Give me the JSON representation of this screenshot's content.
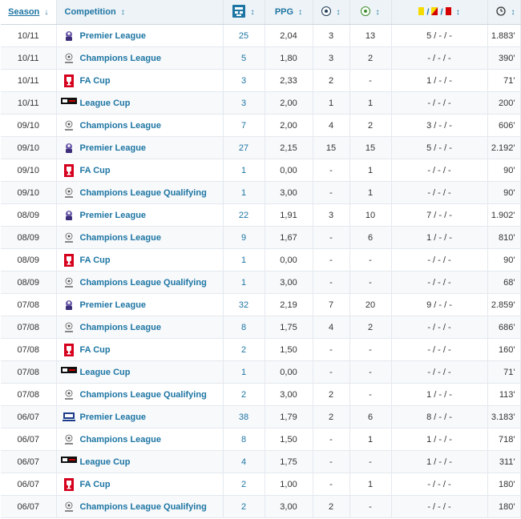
{
  "header": {
    "season": "Season",
    "season_arrow": "↓",
    "competition": "Competition",
    "sort_arrow": "↕",
    "ppg": "PPG",
    "apps_icon": "squad-icon",
    "goals_icon": "football-icon",
    "assists_icon": "assist-football-icon",
    "cards_sep": "/",
    "minutes_icon": "clock-icon"
  },
  "colors": {
    "link": "#1d75a3",
    "header_bg": "#eef3f7",
    "yellow_card": "#f5dc00",
    "red_card": "#d50000"
  },
  "rows": [
    {
      "season": "10/11",
      "competition": "Premier League",
      "logo": "premier-league-logo",
      "apps": "25",
      "ppg": "2,04",
      "goals": "3",
      "assists": "13",
      "cards": "5 / - / -",
      "minutes": "1.883'"
    },
    {
      "season": "10/11",
      "competition": "Champions League",
      "logo": "champions-league-logo",
      "apps": "5",
      "ppg": "1,80",
      "goals": "3",
      "assists": "2",
      "cards": "- / - / -",
      "minutes": "390'"
    },
    {
      "season": "10/11",
      "competition": "FA Cup",
      "logo": "fa-cup-logo",
      "apps": "3",
      "ppg": "2,33",
      "goals": "2",
      "assists": "-",
      "cards": "1 / - / -",
      "minutes": "71'"
    },
    {
      "season": "10/11",
      "competition": "League Cup",
      "logo": "league-cup-logo",
      "apps": "3",
      "ppg": "2,00",
      "goals": "1",
      "assists": "1",
      "cards": "- / - / -",
      "minutes": "200'"
    },
    {
      "season": "09/10",
      "competition": "Champions League",
      "logo": "champions-league-logo",
      "apps": "7",
      "ppg": "2,00",
      "goals": "4",
      "assists": "2",
      "cards": "3 / - / -",
      "minutes": "606'"
    },
    {
      "season": "09/10",
      "competition": "Premier League",
      "logo": "premier-league-logo",
      "apps": "27",
      "ppg": "2,15",
      "goals": "15",
      "assists": "15",
      "cards": "5 / - / -",
      "minutes": "2.192'"
    },
    {
      "season": "09/10",
      "competition": "FA Cup",
      "logo": "fa-cup-logo",
      "apps": "1",
      "ppg": "0,00",
      "goals": "-",
      "assists": "1",
      "cards": "- / - / -",
      "minutes": "90'"
    },
    {
      "season": "09/10",
      "competition": "Champions League Qualifying",
      "logo": "champions-league-logo",
      "apps": "1",
      "ppg": "3,00",
      "goals": "-",
      "assists": "1",
      "cards": "- / - / -",
      "minutes": "90'"
    },
    {
      "season": "08/09",
      "competition": "Premier League",
      "logo": "premier-league-logo",
      "apps": "22",
      "ppg": "1,91",
      "goals": "3",
      "assists": "10",
      "cards": "7 / - / -",
      "minutes": "1.902'"
    },
    {
      "season": "08/09",
      "competition": "Champions League",
      "logo": "champions-league-logo",
      "apps": "9",
      "ppg": "1,67",
      "goals": "-",
      "assists": "6",
      "cards": "1 / - / -",
      "minutes": "810'"
    },
    {
      "season": "08/09",
      "competition": "FA Cup",
      "logo": "fa-cup-logo",
      "apps": "1",
      "ppg": "0,00",
      "goals": "-",
      "assists": "-",
      "cards": "- / - / -",
      "minutes": "90'"
    },
    {
      "season": "08/09",
      "competition": "Champions League Qualifying",
      "logo": "champions-league-logo",
      "apps": "1",
      "ppg": "3,00",
      "goals": "-",
      "assists": "-",
      "cards": "- / - / -",
      "minutes": "68'"
    },
    {
      "season": "07/08",
      "competition": "Premier League",
      "logo": "premier-league-logo",
      "apps": "32",
      "ppg": "2,19",
      "goals": "7",
      "assists": "20",
      "cards": "9 / - / -",
      "minutes": "2.859'"
    },
    {
      "season": "07/08",
      "competition": "Champions League",
      "logo": "champions-league-logo",
      "apps": "8",
      "ppg": "1,75",
      "goals": "4",
      "assists": "2",
      "cards": "- / - / -",
      "minutes": "686'"
    },
    {
      "season": "07/08",
      "competition": "FA Cup",
      "logo": "fa-cup-logo",
      "apps": "2",
      "ppg": "1,50",
      "goals": "-",
      "assists": "-",
      "cards": "- / - / -",
      "minutes": "160'"
    },
    {
      "season": "07/08",
      "competition": "League Cup",
      "logo": "league-cup-logo",
      "apps": "1",
      "ppg": "0,00",
      "goals": "-",
      "assists": "-",
      "cards": "- / - / -",
      "minutes": "71'"
    },
    {
      "season": "07/08",
      "competition": "Champions League Qualifying",
      "logo": "champions-league-logo",
      "apps": "2",
      "ppg": "3,00",
      "goals": "2",
      "assists": "-",
      "cards": "1 / - / -",
      "minutes": "113'"
    },
    {
      "season": "06/07",
      "competition": "Premier League",
      "logo": "premier-league-old-logo",
      "apps": "38",
      "ppg": "1,79",
      "goals": "2",
      "assists": "6",
      "cards": "8 / - / -",
      "minutes": "3.183'"
    },
    {
      "season": "06/07",
      "competition": "Champions League",
      "logo": "champions-league-logo",
      "apps": "8",
      "ppg": "1,50",
      "goals": "-",
      "assists": "1",
      "cards": "1 / - / -",
      "minutes": "718'"
    },
    {
      "season": "06/07",
      "competition": "League Cup",
      "logo": "league-cup-logo",
      "apps": "4",
      "ppg": "1,75",
      "goals": "-",
      "assists": "-",
      "cards": "1 / - / -",
      "minutes": "311'"
    },
    {
      "season": "06/07",
      "competition": "FA Cup",
      "logo": "fa-cup-logo",
      "apps": "2",
      "ppg": "1,00",
      "goals": "-",
      "assists": "1",
      "cards": "- / - / -",
      "minutes": "180'"
    },
    {
      "season": "06/07",
      "competition": "Champions League Qualifying",
      "logo": "champions-league-logo",
      "apps": "2",
      "ppg": "3,00",
      "goals": "2",
      "assists": "-",
      "cards": "- / - / -",
      "minutes": "180'"
    }
  ]
}
